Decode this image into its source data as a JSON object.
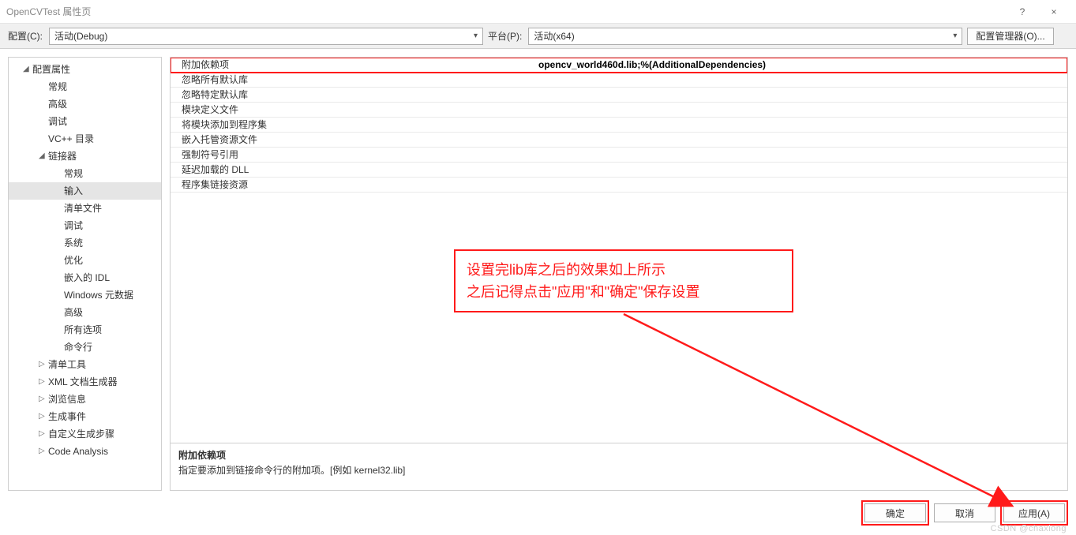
{
  "window": {
    "title": "OpenCVTest 属性页",
    "help_icon": "?",
    "close_icon": "×"
  },
  "toolbar": {
    "config_label": "配置(C):",
    "config_value": "活动(Debug)",
    "platform_label": "平台(P):",
    "platform_value": "活动(x64)",
    "config_mgr_label": "配置管理器(O)..."
  },
  "tree": {
    "root": "配置属性",
    "items_lvl2": [
      "常规",
      "高级",
      "调试",
      "VC++ 目录"
    ],
    "linker": "链接器",
    "linker_items": [
      "常规",
      "输入",
      "清单文件",
      "调试",
      "系统",
      "优化",
      "嵌入的 IDL",
      "Windows 元数据",
      "高级",
      "所有选项",
      "命令行"
    ],
    "tail": [
      "清单工具",
      "XML 文档生成器",
      "浏览信息",
      "生成事件",
      "自定义生成步骤",
      "Code Analysis"
    ]
  },
  "props": [
    {
      "name": "附加依赖项",
      "value": "opencv_world460d.lib;%(AdditionalDependencies)",
      "hl": true
    },
    {
      "name": "忽略所有默认库",
      "value": ""
    },
    {
      "name": "忽略特定默认库",
      "value": ""
    },
    {
      "name": "模块定义文件",
      "value": ""
    },
    {
      "name": "将模块添加到程序集",
      "value": ""
    },
    {
      "name": "嵌入托管资源文件",
      "value": ""
    },
    {
      "name": "强制符号引用",
      "value": ""
    },
    {
      "name": "延迟加载的 DLL",
      "value": ""
    },
    {
      "name": "程序集链接资源",
      "value": ""
    }
  ],
  "description": {
    "title": "附加依赖项",
    "text": "指定要添加到链接命令行的附加项。[例如 kernel32.lib]"
  },
  "annotation": {
    "line1": "设置完lib库之后的效果如上所示",
    "line2": "之后记得点击\"应用\"和\"确定\"保存设置"
  },
  "buttons": {
    "ok": "确定",
    "cancel": "取消",
    "apply": "应用(A)"
  },
  "watermark": "CSDN @chaxiong"
}
